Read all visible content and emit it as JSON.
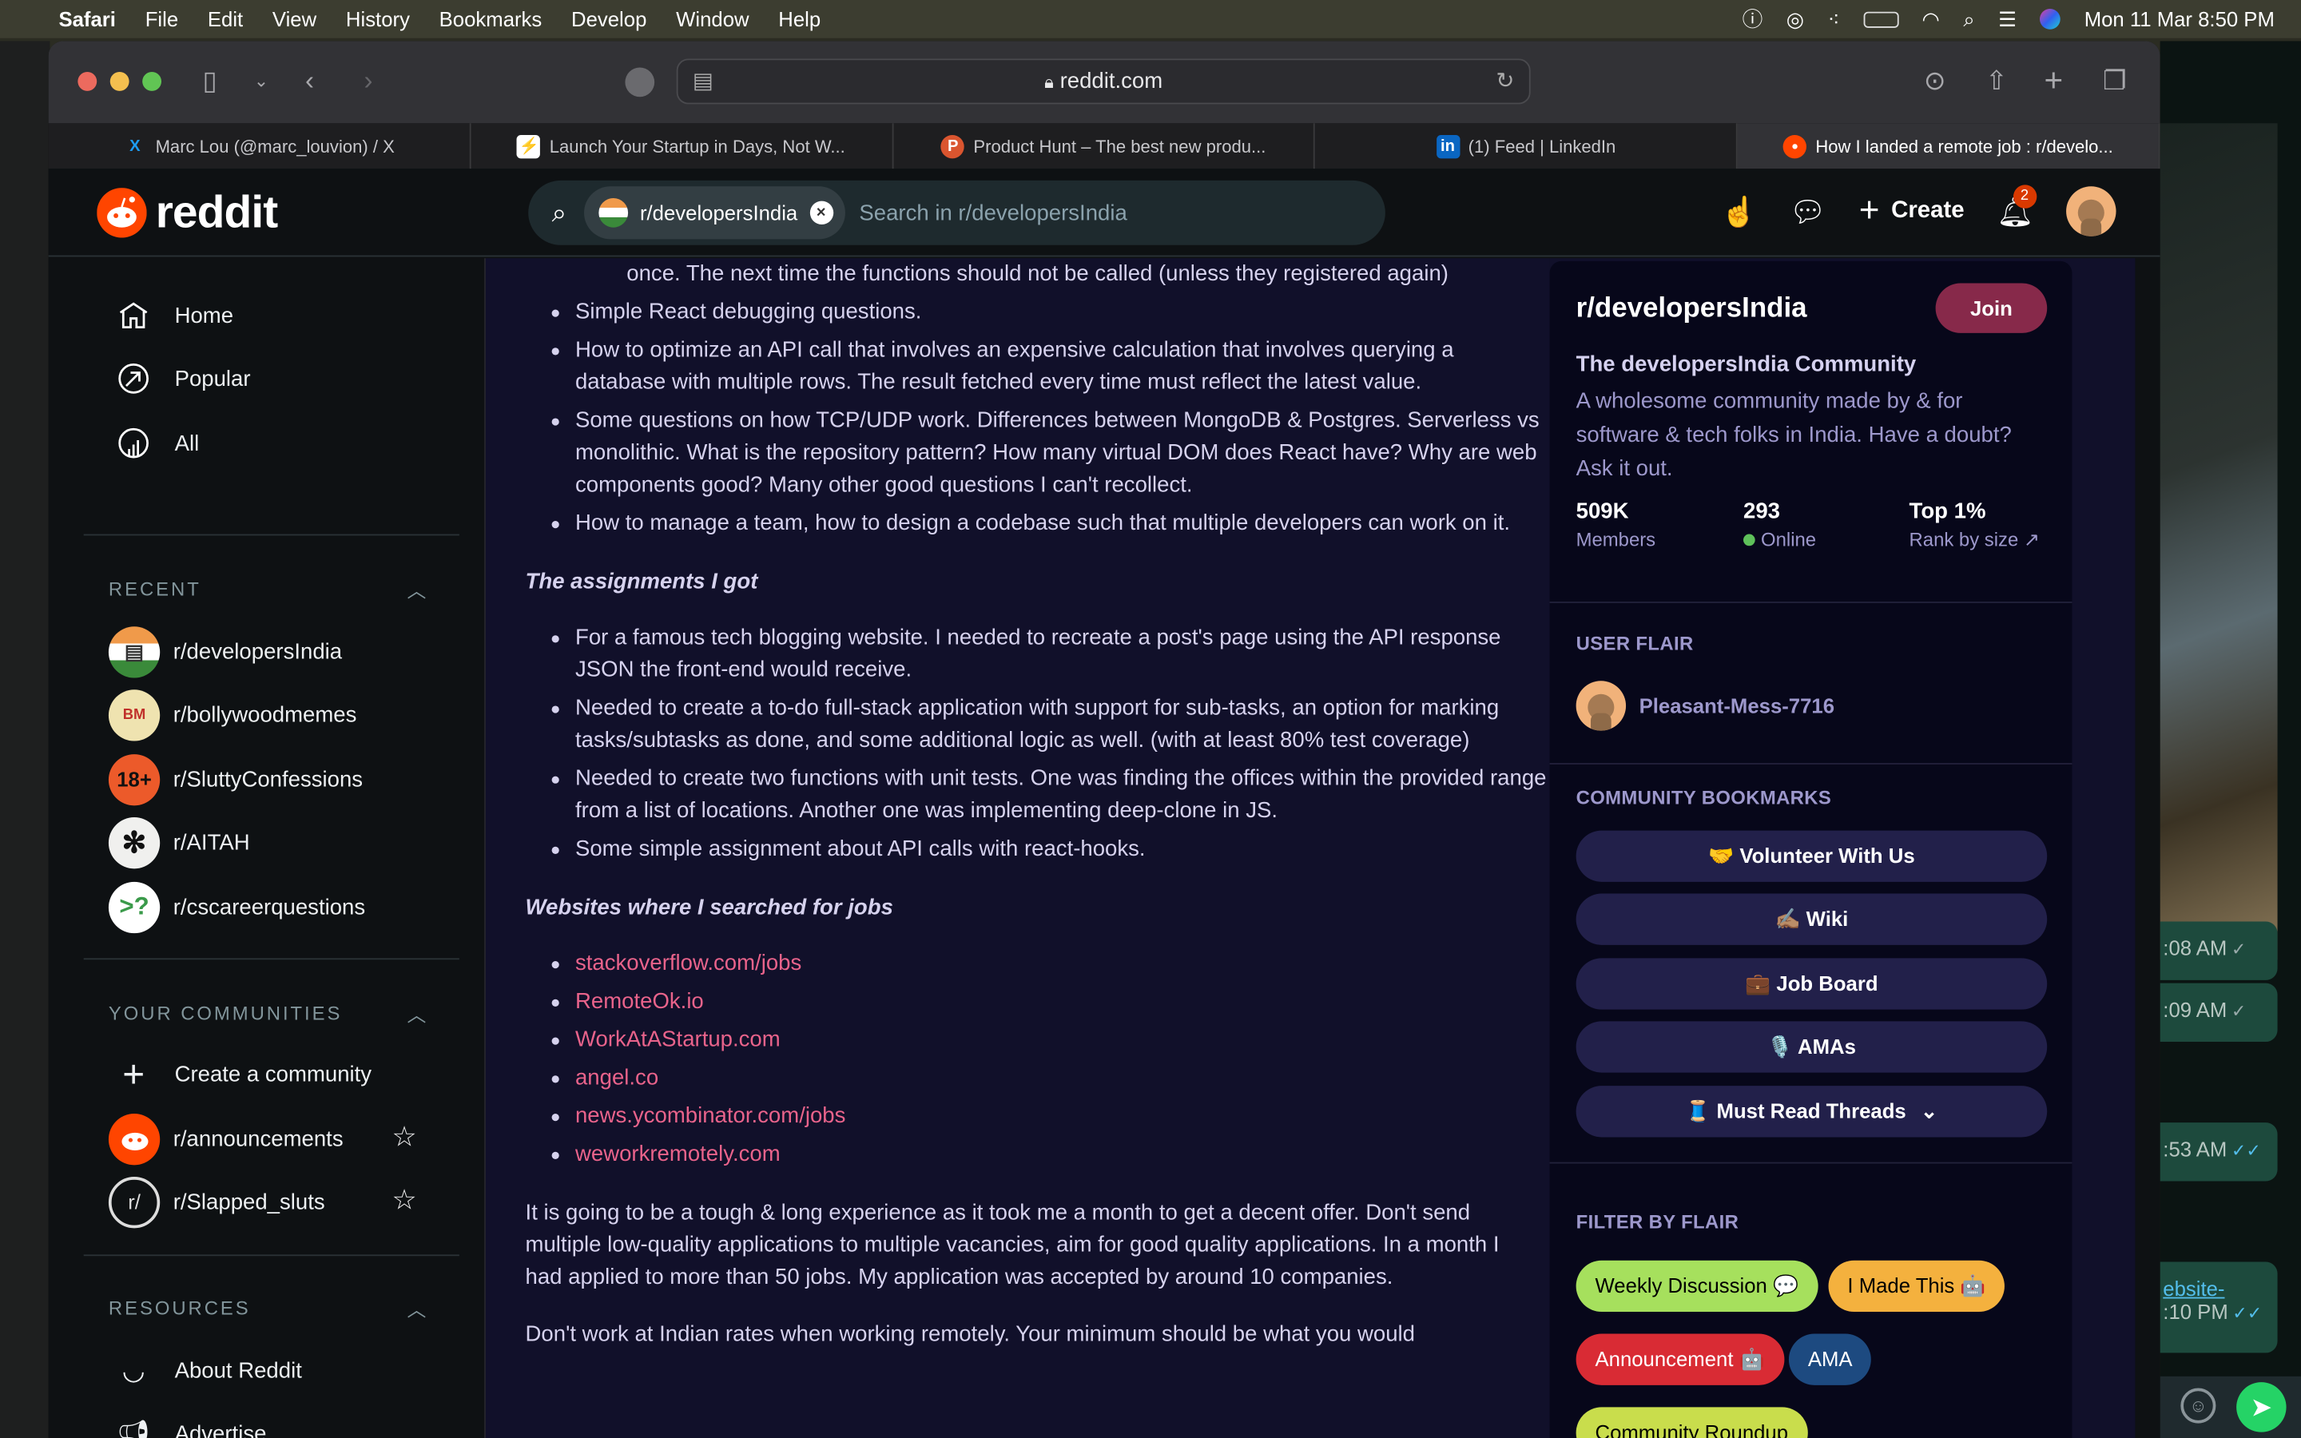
{
  "menubar": {
    "app": "Safari",
    "items": [
      "File",
      "Edit",
      "View",
      "History",
      "Bookmarks",
      "Develop",
      "Window",
      "Help"
    ],
    "clock": "Mon 11 Mar  8:50 PM"
  },
  "browser": {
    "url": "reddit.com",
    "tabs": [
      {
        "title": "Marc Lou (@marc_louvion) / X",
        "icon": "x-icon",
        "color": "#1d9bf0",
        "glyph": "X"
      },
      {
        "title": "Launch Your Startup in Days, Not W...",
        "icon": "lightning-icon",
        "color": "#f5c518",
        "glyph": "⚡"
      },
      {
        "title": "Product Hunt – The best new produ...",
        "icon": "product-hunt-icon",
        "color": "#da552f",
        "glyph": "P"
      },
      {
        "title": "(1) Feed | LinkedIn",
        "icon": "linkedin-icon",
        "color": "#0a66c2",
        "glyph": "in"
      },
      {
        "title": "How I landed a remote job : r/develo...",
        "icon": "reddit-icon",
        "color": "#ff4500",
        "glyph": "●"
      }
    ]
  },
  "header": {
    "logo": "reddit",
    "search_chip": "r/developersIndia",
    "search_placeholder": "Search in r/developersIndia",
    "create": "Create",
    "notifications": "2"
  },
  "sidebar": {
    "nav": [
      "Home",
      "Popular",
      "All"
    ],
    "recent_label": "RECENT",
    "recent": [
      {
        "name": "r/developersIndia",
        "bg": "#e8e8e8",
        "glyph": "▤"
      },
      {
        "name": "r/bollywoodmemes",
        "bg": "#efe3b0",
        "glyph": "BM"
      },
      {
        "name": "r/SluttyConfessions",
        "bg": "#ec5a2a",
        "glyph": "18+"
      },
      {
        "name": "r/AITAH",
        "bg": "#f0f0ee",
        "glyph": "✻"
      },
      {
        "name": "r/cscareerquestions",
        "bg": "#ffffff",
        "glyph": ">?"
      }
    ],
    "communities_label": "YOUR COMMUNITIES",
    "create_community": "Create a community",
    "communities": [
      "r/announcements",
      "r/Slapped_sluts"
    ],
    "resources_label": "RESOURCES",
    "resources": [
      "About Reddit",
      "Advertise"
    ]
  },
  "post": {
    "continued_line": "once. The next time the functions should not be called (unless they registered again)",
    "questions": [
      "Simple React debugging questions.",
      "How to optimize an API call that involves an expensive calculation that involves querying a database with multiple rows. The result fetched every time must reflect the latest value.",
      "Some questions on how TCP/UDP work. Differences between MongoDB & Postgres. Serverless vs monolithic. What is the repository pattern? How many virtual DOM does React have? Why are web components good? Many other good questions I can't recollect.",
      "How to manage a team, how to design a codebase such that multiple developers can work on it."
    ],
    "assignments_heading": "The assignments I got",
    "assignments": [
      "For a famous tech blogging website. I needed to recreate a post's page using the API response JSON the front-end would receive.",
      "Needed to create a to-do full-stack application with support for sub-tasks, an option for marking tasks/subtasks as done, and some additional logic as well. (with at least 80% test coverage)",
      "Needed to create two functions with unit tests. One was finding the offices within the provided range from a list of locations. Another one was implementing deep-clone in JS.",
      "Some simple assignment about API calls with react-hooks."
    ],
    "websites_heading": "Websites where I searched for jobs",
    "websites": [
      "stackoverflow.com/jobs",
      "RemoteOk.io",
      "WorkAtAStartup.com",
      "angel.co",
      "news.ycombinator.com/jobs",
      "weworkremotely.com"
    ],
    "paragraph1": "It is going to be a tough & long experience as it took me a month to get a decent offer. Don't send multiple low-quality applications to multiple vacancies, aim for good quality applications. In a month I had applied to more than 50 jobs. My application was accepted by around 10 companies.",
    "paragraph2": "Don't work at Indian rates when working remotely. Your minimum should be what you would"
  },
  "community": {
    "name": "r/developersIndia",
    "join": "Join",
    "title": "The developersIndia Community",
    "description": "A wholesome community made by & for software & tech folks in India. Have a doubt? Ask it out.",
    "members_value": "509K",
    "members_label": "Members",
    "online_value": "293",
    "online_label": "Online",
    "rank_value": "Top 1%",
    "rank_label": "Rank by size",
    "user_flair_label": "USER FLAIR",
    "username": "Pleasant-Mess-7716",
    "bookmarks_label": "COMMUNITY BOOKMARKS",
    "bookmarks": [
      "🤝 Volunteer With Us",
      "✍🏽 Wiki",
      "💼 Job Board",
      "🎙️ AMAs",
      "🧵 Must Read Threads"
    ],
    "filter_label": "FILTER BY FLAIR",
    "flairs": [
      {
        "label": "Weekly Discussion 💬",
        "bg": "#a6e05d",
        "fg": "#000000"
      },
      {
        "label": "I Made This 🤖",
        "bg": "#f4b13e",
        "fg": "#000000"
      },
      {
        "label": "Announcement 🤖",
        "bg": "#d92b34",
        "fg": "#ffffff"
      },
      {
        "label": "AMA",
        "bg": "#1d4a80",
        "fg": "#ffffff"
      },
      {
        "label": "Community Roundup",
        "bg": "#c9dd4c",
        "fg": "#000000"
      }
    ]
  },
  "whatsapp": {
    "times": [
      ":08 AM",
      ":09 AM",
      ":53 AM",
      ":10 PM"
    ],
    "link_fragment": "ebsite-"
  },
  "colors": {
    "accent": "#ff4500",
    "join": "#87294a",
    "link": "#e9638b",
    "online": "#5ec05a"
  }
}
